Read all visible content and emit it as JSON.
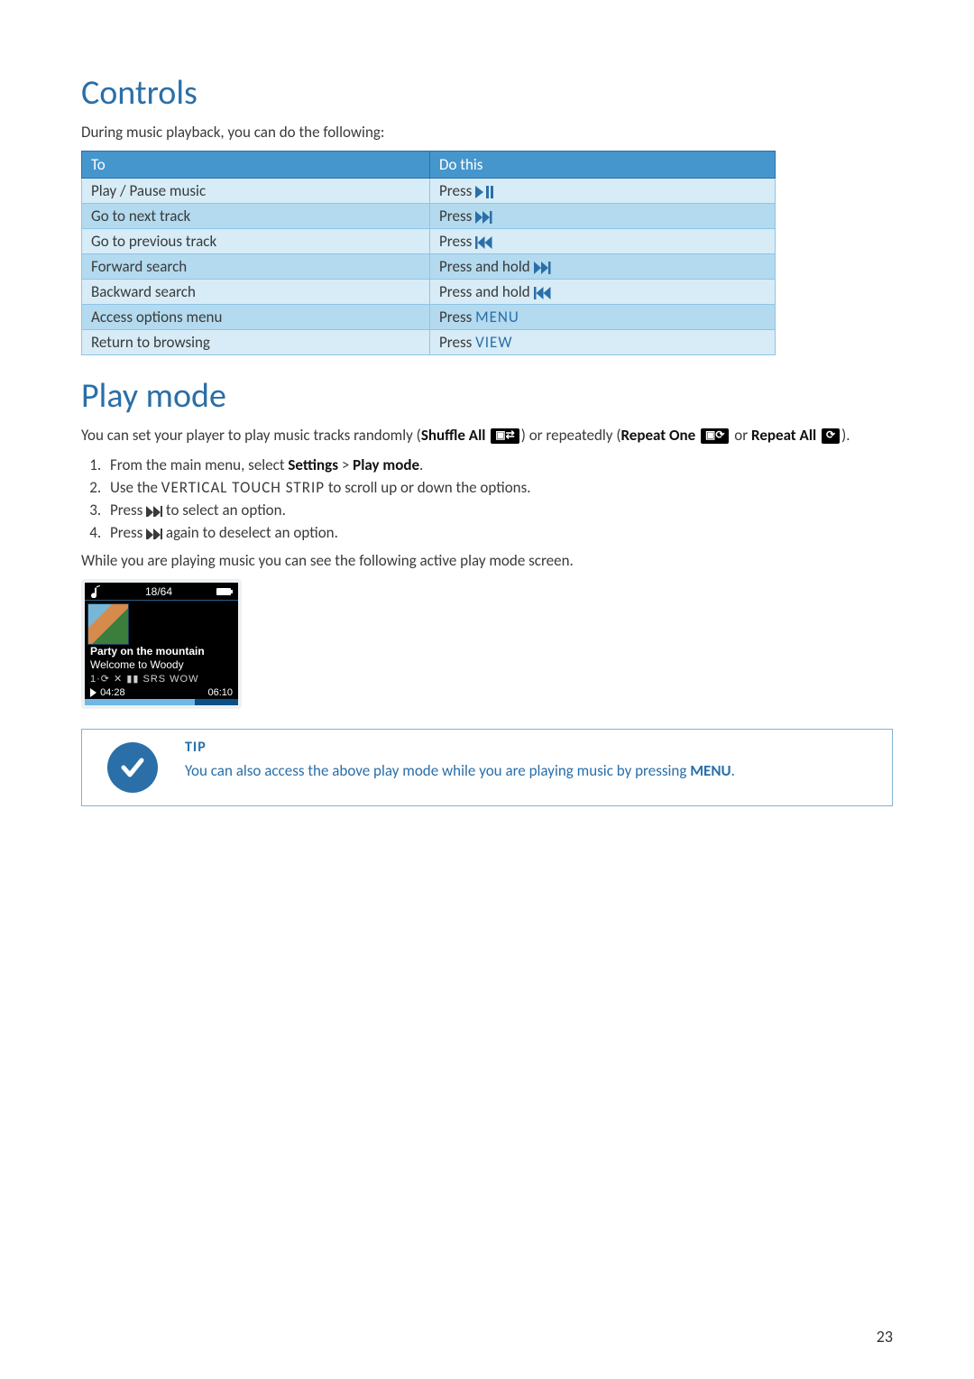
{
  "page_number": "23",
  "sections": {
    "controls": {
      "heading": "Controls",
      "intro": "During music playback, you can do the following:",
      "table": {
        "headers": {
          "to": "To",
          "do": "Do this"
        },
        "rows": [
          {
            "to": "Play / Pause music",
            "do_prefix": "Press ",
            "icon": "play-pause"
          },
          {
            "to": "Go to next track",
            "do_prefix": "Press ",
            "icon": "next"
          },
          {
            "to": "Go to previous track",
            "do_prefix": "Press ",
            "icon": "prev"
          },
          {
            "to": "Forward search",
            "do_prefix": "Press and hold ",
            "icon": "next"
          },
          {
            "to": "Backward search",
            "do_prefix": "Press and hold ",
            "icon": "prev"
          },
          {
            "to": "Access options menu",
            "do_prefix": "Press ",
            "keyword": "MENU"
          },
          {
            "to": "Return to browsing",
            "do_prefix": "Press ",
            "keyword": "VIEW"
          }
        ]
      }
    },
    "playmode": {
      "heading": "Play mode",
      "intro": {
        "p1": "You can set your player to play music tracks randomly (",
        "shuffle_label": "Shuffle All",
        "p2": ") or repeatedly (",
        "repeat_one_label": "Repeat One",
        "p3": " or ",
        "repeat_all_label": "Repeat All",
        "p4": ")."
      },
      "steps": {
        "s1a": "From the main menu, select ",
        "s1b": "Settings",
        "s1c": " > ",
        "s1d": "Play mode",
        "s1e": ".",
        "s2a": "Use the ",
        "s2b": "VERTICAL TOUCH STRIP",
        "s2c": " to scroll up or down the options.",
        "s3a": "Press ",
        "s3b": " to select an option.",
        "s4a": "Press ",
        "s4b": " again to deselect an option."
      },
      "after_steps": "While you are playing music you can see the following active play mode screen.",
      "player_screen": {
        "counter": "18/64",
        "title": "Party on the mountain",
        "subtitle": "Welcome to Woody",
        "modes": "1·⟳ ✕ ▮▮ SRS WOW",
        "elapsed": "04:28",
        "total": "06:10"
      },
      "tip": {
        "label": "TIP",
        "body_a": "You can also access the above play mode while you are playing music by pressing ",
        "body_b": "MENU",
        "body_c": "."
      }
    }
  }
}
